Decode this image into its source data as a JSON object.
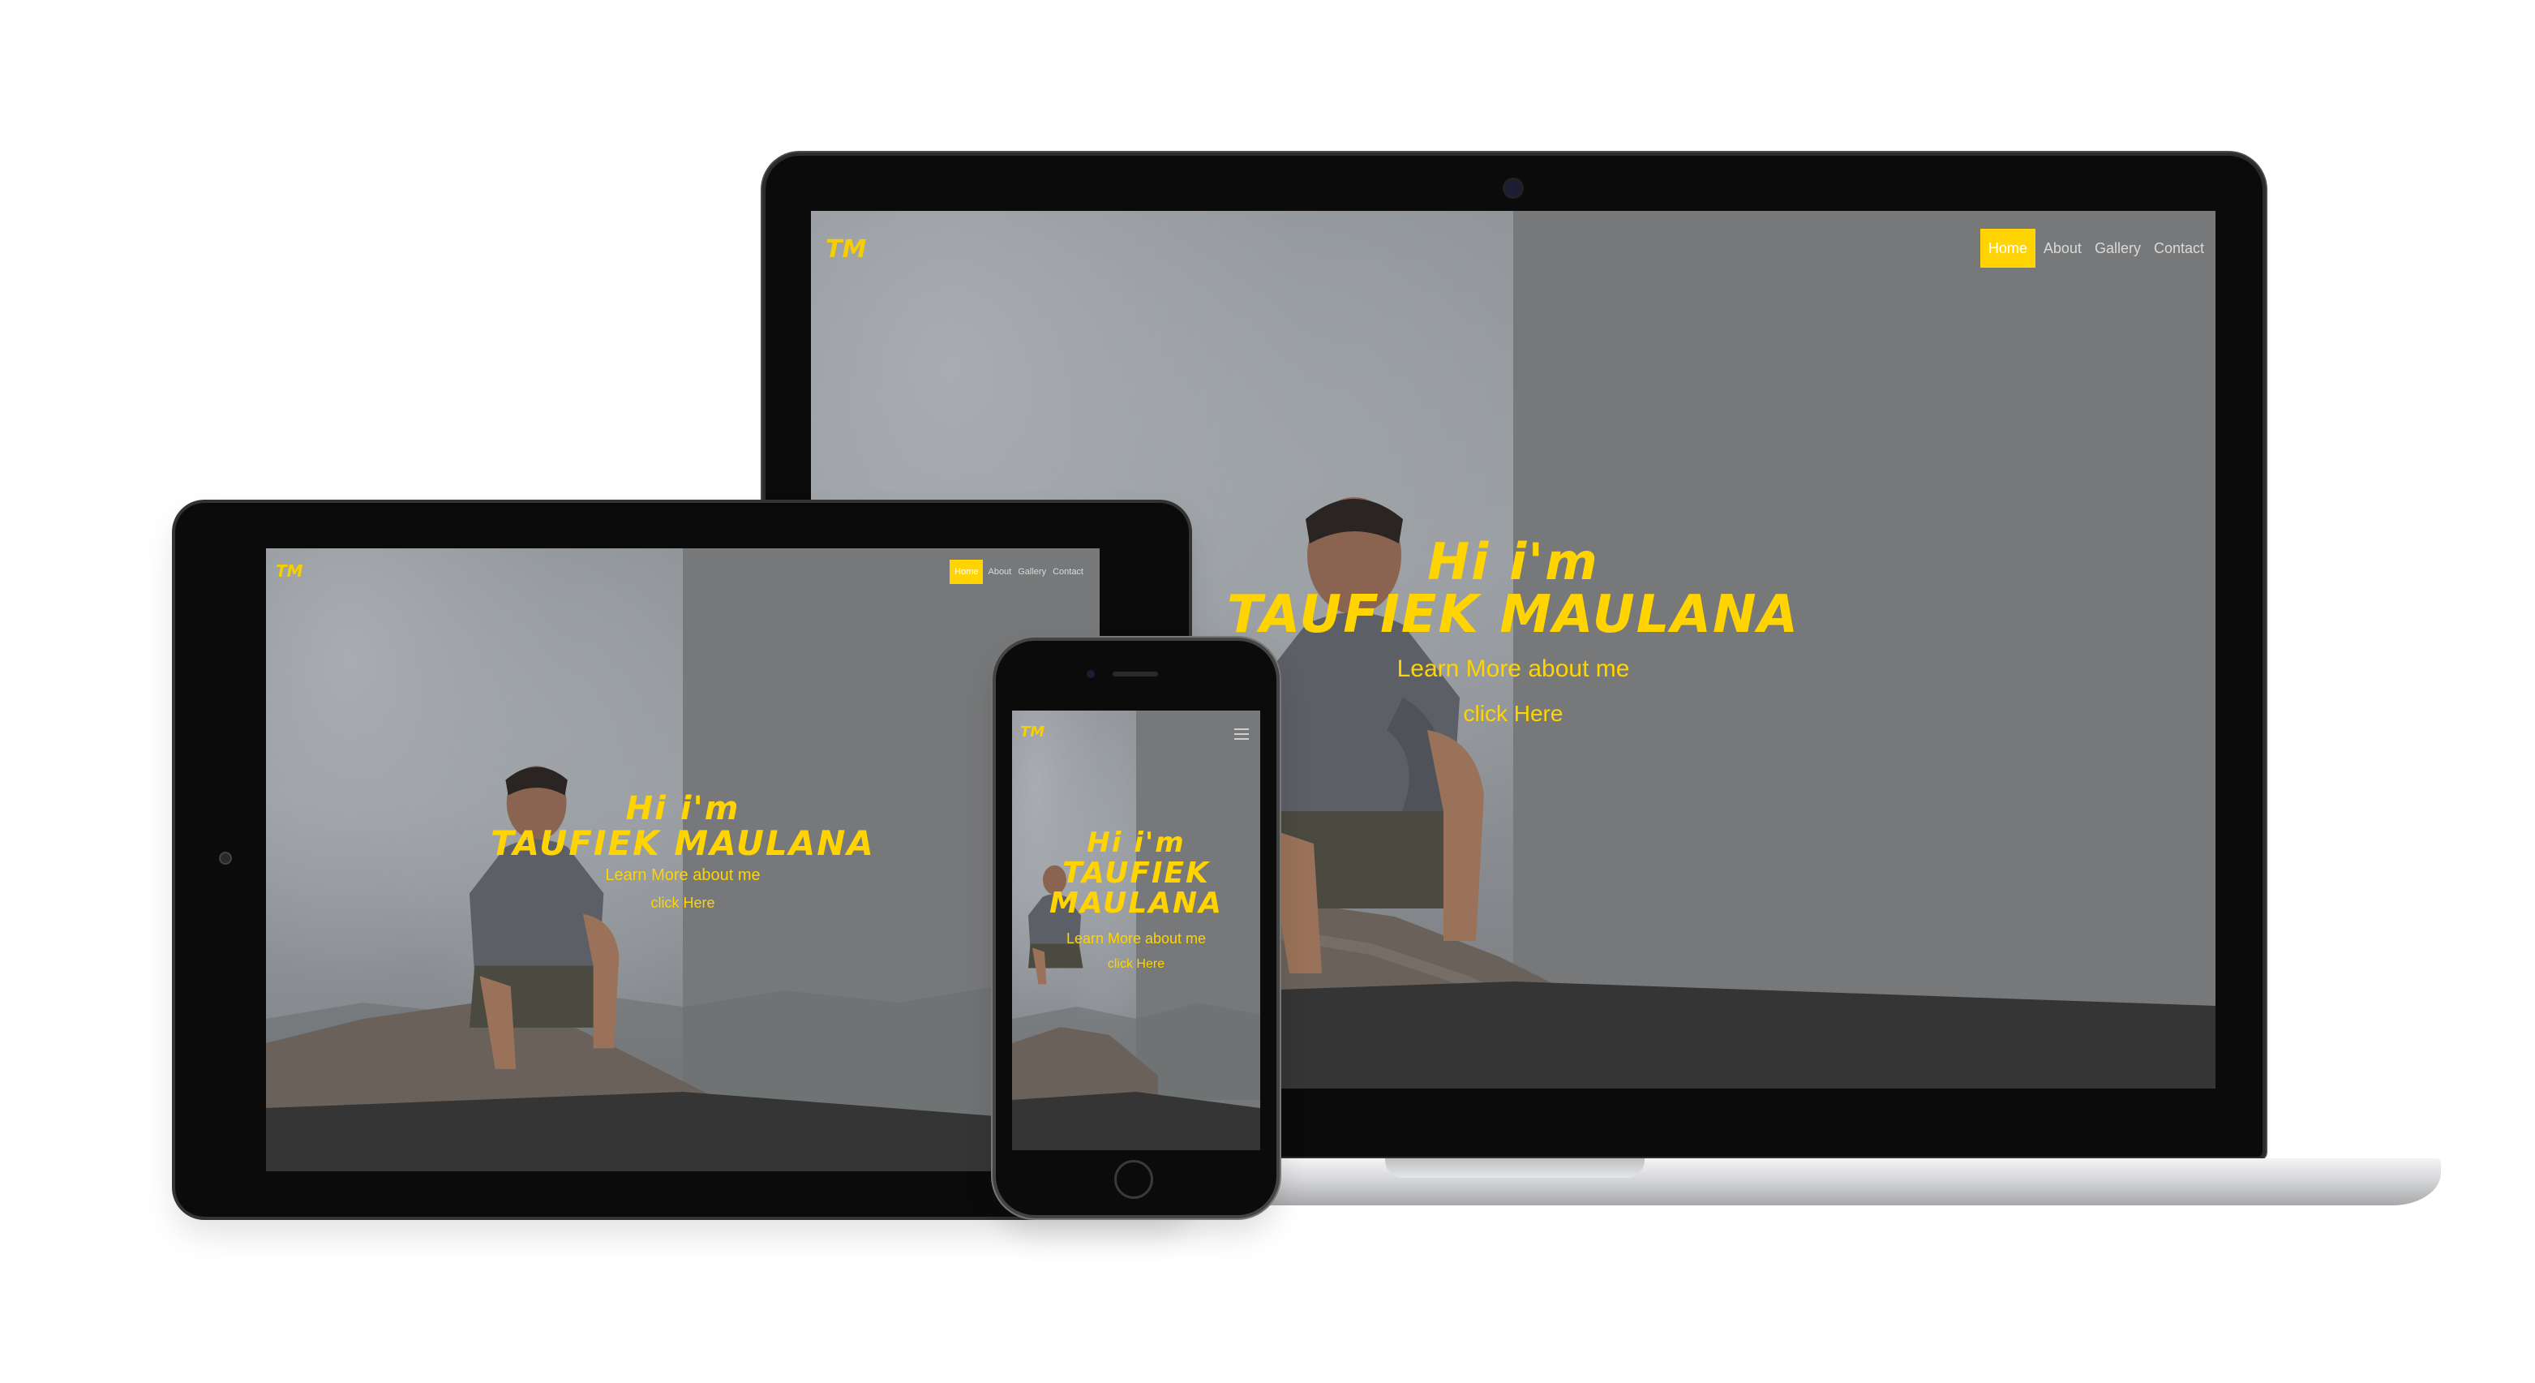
{
  "site": {
    "logo": "TM",
    "nav": [
      "Home",
      "About",
      "Gallery",
      "Contact"
    ],
    "active_nav": "Home",
    "hero": {
      "greeting": "Hi i'm",
      "name": "TAUFIEK MAULANA",
      "name_line1": "TAUFIEK",
      "name_line2": "MAULANA",
      "subtitle": "Learn More about me",
      "cta": "click Here"
    }
  },
  "colors": {
    "accent": "#ffd400",
    "overlay_dark": "#777879",
    "floor": "#353535",
    "device_frame": "#0b0b0b",
    "laptop_base": "#d9dadc"
  },
  "icons": [
    "webcam-icon",
    "home-button-icon",
    "hamburger-menu-icon",
    "speaker-icon"
  ]
}
